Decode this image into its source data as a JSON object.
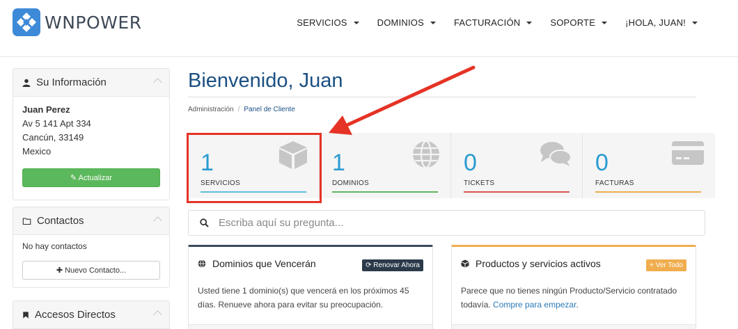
{
  "brand": {
    "name": "WNPOWER"
  },
  "nav": [
    {
      "label": "SERVICIOS"
    },
    {
      "label": "DOMINIOS"
    },
    {
      "label": "FACTURACIÓN"
    },
    {
      "label": "SOPORTE"
    },
    {
      "label": "¡HOLA, JUAN!"
    }
  ],
  "sidebar": {
    "info": {
      "title": "Su Información",
      "name": "Juan Perez",
      "address1": "Av 5 141 Apt 334",
      "address2": "Cancún, 33149",
      "country": "Mexico",
      "update_label": "✎ Actualizar"
    },
    "contacts": {
      "title": "Contactos",
      "empty": "No hay contactos",
      "new_label": "✚ Nuevo Contacto..."
    },
    "shortcuts": {
      "title": "Accesos Directos"
    }
  },
  "main": {
    "title": "Bienvenido, Juan",
    "breadcrumb": {
      "root": "Administración",
      "separator": "/",
      "current": "Panel de Cliente"
    },
    "tiles": [
      {
        "count": "1",
        "label": "SERVICIOS",
        "color": "#5bc0de",
        "icon": "cube-icon"
      },
      {
        "count": "1",
        "label": "DOMINIOS",
        "color": "#5cb85c",
        "icon": "globe-icon"
      },
      {
        "count": "0",
        "label": "TICKETS",
        "color": "#d9534f",
        "icon": "comments-icon"
      },
      {
        "count": "0",
        "label": "FACTURAS",
        "color": "#f0ad4e",
        "icon": "credit-card-icon"
      }
    ],
    "search": {
      "placeholder": "Escriba aquí su pregunta..."
    },
    "domains_card": {
      "title": "Dominios que Vencerán",
      "action": "⟳ Renovar Ahora",
      "text": "Usted tiene 1 dominio(s) que vencerá en los próximos 45 días. Renueve ahora para evitar su preocupación.",
      "accent": "#3a4a5c"
    },
    "products_card": {
      "title": "Productos y servicios activos",
      "action": "+ Ver Todo",
      "text": "Parece que no tienes ningún Producto/Servicio contratado todavía.",
      "link": "Compre para empezar",
      "after_link": ".",
      "accent": "#f0ad4e"
    }
  }
}
